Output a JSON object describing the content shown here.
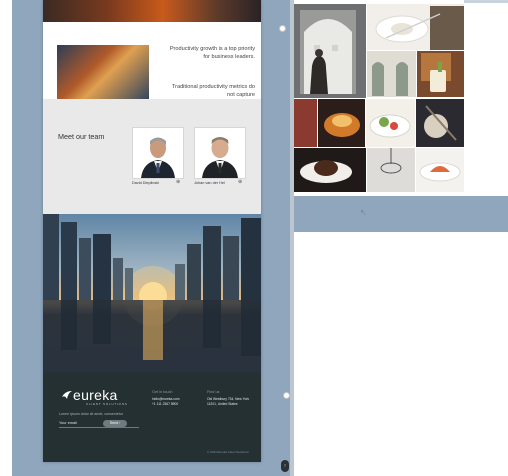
{
  "productivity": {
    "paragraph_1": "Productivity growth is a top priority for business leaders.",
    "paragraph_2": "Traditional productivity metrics do not capture"
  },
  "team": {
    "title": "Meet our team",
    "members": [
      {
        "name": "David Dieplinski",
        "link_icon": "linkedin-icon"
      },
      {
        "name": "Johan van der Hel",
        "link_icon": "linkedin-icon"
      }
    ]
  },
  "footer": {
    "logo_text": "eureka",
    "logo_sub": "CLIENT SOLUTIONS",
    "tagline": "Lorem ipsum dolor sit amet, consectetur",
    "email_placeholder": "Your email",
    "send_label": "Send",
    "contact": {
      "heading": "Get in touch",
      "email": "hello@eureka.com",
      "phone": "+1 111 2367 8900"
    },
    "address": {
      "heading": "Find us",
      "line": "Old Westbury 734, New York 11201, United States"
    },
    "copyright": "© 2024 Eureka Client Solutions"
  },
  "colors": {
    "panel": "#8fa6bd",
    "footer": "#253033",
    "team_bg": "#e9e9e9"
  }
}
